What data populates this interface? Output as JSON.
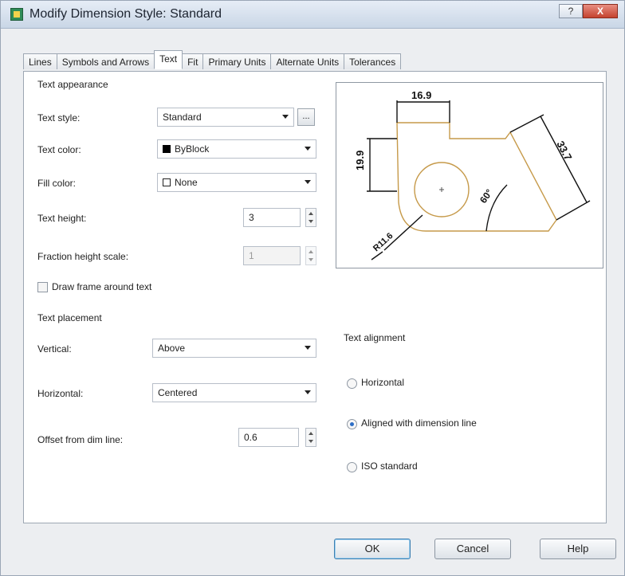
{
  "window": {
    "title": "Modify Dimension Style: Standard",
    "help_glyph": "?",
    "close_glyph": "X"
  },
  "tabs": [
    {
      "label": "Lines"
    },
    {
      "label": "Symbols and Arrows"
    },
    {
      "label": "Text"
    },
    {
      "label": "Fit"
    },
    {
      "label": "Primary Units"
    },
    {
      "label": "Alternate Units"
    },
    {
      "label": "Tolerances"
    }
  ],
  "text_appearance": {
    "group_label": "Text appearance",
    "text_style_label": "Text style:",
    "text_style_value": "Standard",
    "text_style_browse": "...",
    "text_color_label": "Text color:",
    "text_color_value": "ByBlock",
    "fill_color_label": "Fill color:",
    "fill_color_value": "None",
    "text_height_label": "Text height:",
    "text_height_value": "3",
    "fraction_label": "Fraction height scale:",
    "fraction_value": "1",
    "draw_frame_label": "Draw frame around text"
  },
  "text_placement": {
    "group_label": "Text placement",
    "vertical_label": "Vertical:",
    "vertical_value": "Above",
    "horizontal_label": "Horizontal:",
    "horizontal_value": "Centered",
    "offset_label": "Offset from dim line:",
    "offset_value": "0.6"
  },
  "text_alignment": {
    "group_label": "Text alignment",
    "options": [
      {
        "label": "Horizontal",
        "selected": false
      },
      {
        "label": "Aligned with dimension line",
        "selected": true
      },
      {
        "label": "ISO standard",
        "selected": false
      }
    ]
  },
  "preview": {
    "dim_top": "16.9",
    "dim_left": "19.9",
    "dim_right": "33.7",
    "dim_angle": "60°",
    "dim_radius": "R11.6"
  },
  "buttons": {
    "ok": "OK",
    "cancel": "Cancel",
    "help": "Help"
  },
  "colors": {
    "geometry": "#c69a4a",
    "dimension": "#111111",
    "radio_selected": "#2d6ec6"
  }
}
